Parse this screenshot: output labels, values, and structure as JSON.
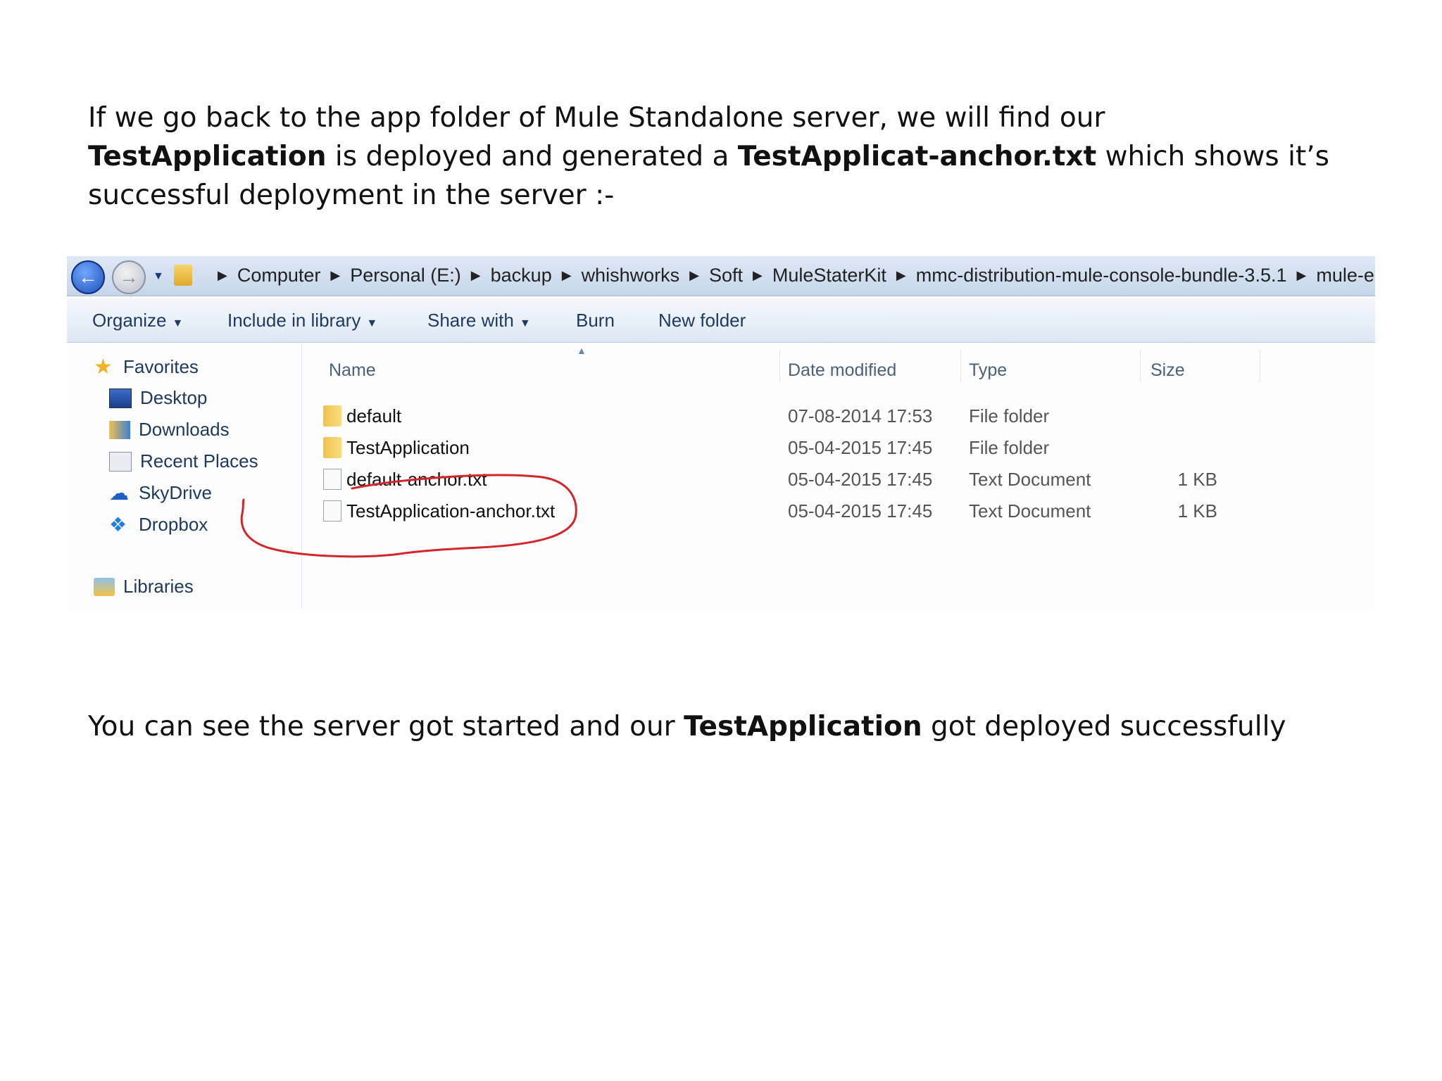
{
  "intro": {
    "line1": "If we go back to the app folder of Mule Standalone server, we will find our",
    "bold1": "TestApplication",
    "mid1": " is deployed and generated a ",
    "bold2": "TestApplicat-anchor.txt",
    "mid2": " which shows it’s",
    "line3": "successful deployment in the server :-"
  },
  "outro": {
    "pre": "You can see the server got started and our ",
    "bold": "TestApplication",
    "post": " got deployed successfully"
  },
  "explorer": {
    "breadcrumb": [
      "Computer",
      "Personal (E:)",
      "backup",
      "whishworks",
      "Soft",
      "MuleStaterKit",
      "mmc-distribution-mule-console-bundle-3.5.1",
      "mule-en"
    ],
    "toolbar": {
      "organize": "Organize",
      "include": "Include in library",
      "share": "Share with",
      "burn": "Burn",
      "new_folder": "New folder"
    },
    "nav": {
      "favorites": "Favorites",
      "desktop": "Desktop",
      "downloads": "Downloads",
      "recent": "Recent Places",
      "skydrive": "SkyDrive",
      "dropbox": "Dropbox",
      "libraries": "Libraries"
    },
    "columns": {
      "name": "Name",
      "date": "Date modified",
      "type": "Type",
      "size": "Size"
    },
    "files": [
      {
        "name": "default",
        "date": "07-08-2014 17:53",
        "type": "File folder",
        "size": "",
        "icon": "folder-icon"
      },
      {
        "name": "TestApplication",
        "date": "05-04-2015 17:45",
        "type": "File folder",
        "size": "",
        "icon": "folder-icon"
      },
      {
        "name": "default-anchor.txt",
        "date": "05-04-2015 17:45",
        "type": "Text Document",
        "size": "1 KB",
        "icon": "text-file-icon"
      },
      {
        "name": "TestApplication-anchor.txt",
        "date": "05-04-2015 17:45",
        "type": "Text Document",
        "size": "1 KB",
        "icon": "text-file-icon"
      }
    ],
    "annotation_color": "#d1262c"
  }
}
